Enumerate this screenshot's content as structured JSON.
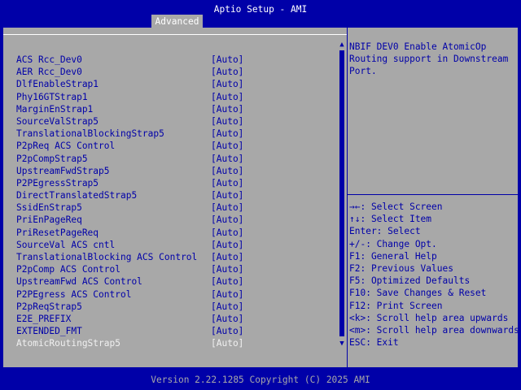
{
  "header": {
    "title": "Aptio Setup - AMI",
    "tabs": [
      "Advanced"
    ]
  },
  "settings": [
    {
      "name": "ACS Rcc_Dev0",
      "value": "[Auto]"
    },
    {
      "name": "AER Rcc_Dev0",
      "value": "[Auto]"
    },
    {
      "name": "DlfEnableStrap1",
      "value": "[Auto]"
    },
    {
      "name": "Phy16GTStrap1",
      "value": "[Auto]"
    },
    {
      "name": "MarginEnStrap1",
      "value": "[Auto]"
    },
    {
      "name": "SourceValStrap5",
      "value": "[Auto]"
    },
    {
      "name": "TranslationalBlockingStrap5",
      "value": "[Auto]"
    },
    {
      "name": "P2pReq ACS Control",
      "value": "[Auto]"
    },
    {
      "name": "P2pCompStrap5",
      "value": "[Auto]"
    },
    {
      "name": "UpstreamFwdStrap5",
      "value": "[Auto]"
    },
    {
      "name": "P2PEgressStrap5",
      "value": "[Auto]"
    },
    {
      "name": "DirectTranslatedStrap5",
      "value": "[Auto]"
    },
    {
      "name": "SsidEnStrap5",
      "value": "[Auto]"
    },
    {
      "name": "PriEnPageReq",
      "value": "[Auto]"
    },
    {
      "name": "PriResetPageReq",
      "value": "[Auto]"
    },
    {
      "name": "SourceVal ACS cntl",
      "value": "[Auto]"
    },
    {
      "name": "TranslationalBlocking ACS Control",
      "value": "[Auto]"
    },
    {
      "name": "P2pComp ACS Control",
      "value": "[Auto]"
    },
    {
      "name": "UpstreamFwd ACS Control",
      "value": "[Auto]"
    },
    {
      "name": "P2PEgress ACS Control",
      "value": "[Auto]"
    },
    {
      "name": "P2pReqStrap5",
      "value": "[Auto]"
    },
    {
      "name": "E2E_PREFIX",
      "value": "[Auto]"
    },
    {
      "name": "EXTENDED_FMT",
      "value": "[Auto]"
    },
    {
      "name": "AtomicRoutingStrap5",
      "value": "[Auto]",
      "selected": true
    }
  ],
  "scrollbar": {
    "up_arrow": "▲",
    "down_arrow": "▼"
  },
  "help": {
    "text": "NBIF DEV0 Enable AtomicOp\nRouting support in Downstream\nPort."
  },
  "keys": [
    "→←: Select Screen",
    "↑↓: Select Item",
    "Enter: Select",
    "+/-: Change Opt.",
    "F1: General Help",
    "F2: Previous Values",
    "F5: Optimized Defaults",
    "F10: Save Changes & Reset",
    "F12: Print Screen",
    "<k>: Scroll help area upwards",
    "<m>: Scroll help area downwards",
    "ESC: Exit"
  ],
  "footer": {
    "version": "Version 2.22.1285 Copyright (C) 2025 AMI"
  },
  "colors": {
    "background": "#0000a8",
    "panel": "#a8a8a8",
    "text": "#0000a8",
    "highlight_text": "#ffffff"
  }
}
